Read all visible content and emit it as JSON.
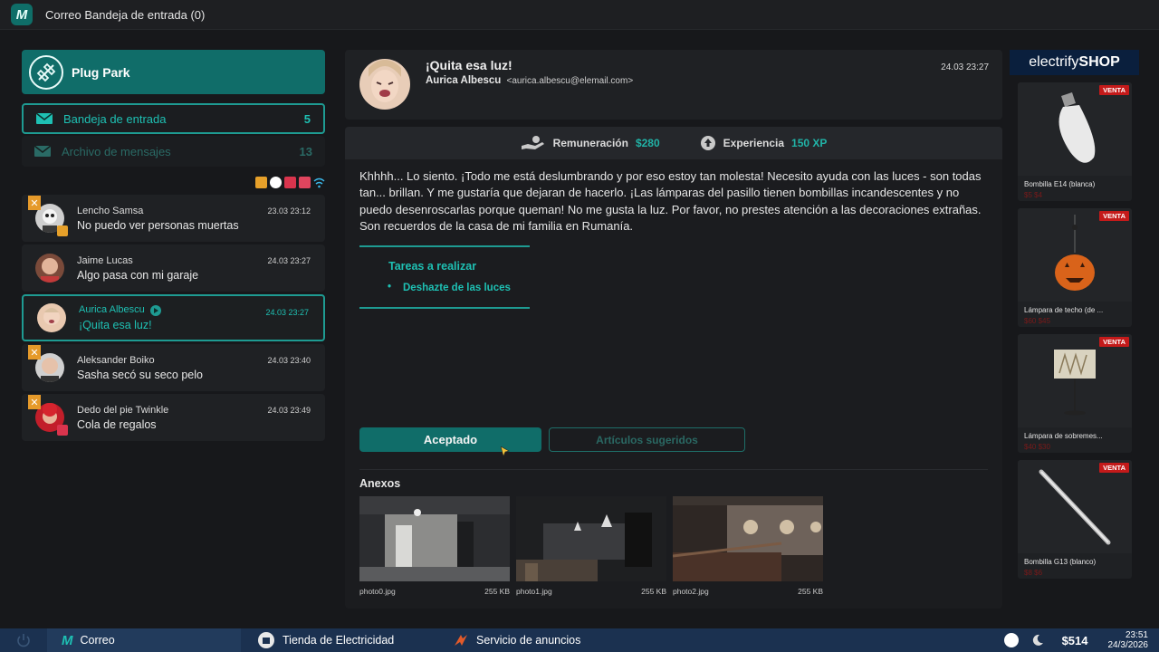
{
  "window": {
    "title": "Correo  Bandeja de entrada (0)",
    "logo_letter": "M"
  },
  "sidebar": {
    "brand": "Plug Park",
    "folders": [
      {
        "label": "Bandeja de entrada",
        "count": "5"
      },
      {
        "label": "Archivo de mensajes",
        "count": "13"
      }
    ],
    "status_icons": [
      "camera-icon",
      "settings-icon",
      "fire-icon",
      "pocket-icon",
      "wifi-icon"
    ]
  },
  "messages": [
    {
      "sender": "Lencho Samsa",
      "subject": "No puedo ver personas muertas",
      "date": "23.03 23:12"
    },
    {
      "sender": "Jaime Lucas",
      "subject": "Algo pasa con mi garaje",
      "date": "24.03 23:27"
    },
    {
      "sender": "Aurica Albescu",
      "subject": "¡Quita esa luz!",
      "date": "24.03 23:27"
    },
    {
      "sender": "Aleksander Boiko",
      "subject": "Sasha secó su seco pelo",
      "date": "24.03 23:40"
    },
    {
      "sender": "Dedo del pie Twinkle",
      "subject": "Cola de regalos",
      "date": "24.03 23:49"
    }
  ],
  "mail": {
    "subject": "¡Quita esa luz!",
    "sender_name": "Aurica Albescu",
    "sender_email": "<aurica.albescu@elemail.com>",
    "date": "24.03 23:27",
    "reward_label": "Remuneración",
    "reward_value": "$280",
    "xp_label": "Experiencia",
    "xp_value": "150 XP",
    "body": "Khhhh... Lo siento. ¡Todo me está deslumbrando y por eso estoy tan molesta! Necesito ayuda con las luces - son todas tan... brillan. Y me gustaría que dejaran de hacerlo. ¡Las lámparas del pasillo tienen bombillas incandescentes y no puedo desenroscarlas porque queman! No me gusta la luz. Por favor, no prestes atención a las decoraciones extrañas. Son recuerdos de la casa de mi familia en Rumanía.",
    "tasks_title": "Tareas a realizar",
    "task_item": "Deshazte de las luces",
    "accept_label": "Aceptado",
    "suggest_label": "Artículos sugeridos",
    "attachments_title": "Anexos",
    "attachments": [
      {
        "name": "photo0.jpg",
        "size": "255 KB"
      },
      {
        "name": "photo1.jpg",
        "size": "255 KB"
      },
      {
        "name": "photo2.jpg",
        "size": "255 KB"
      }
    ]
  },
  "shop": {
    "brand_light": "electrify",
    "brand_bold": "SHOP",
    "badge": "VENTA",
    "items": [
      {
        "name": "Bombilla E14 (blanca)",
        "price": "$5  $4"
      },
      {
        "name": "Lámpara de techo (de ...",
        "price": "$60  $45"
      },
      {
        "name": "Lámpara de sobremes...",
        "price": "$40  $30"
      },
      {
        "name": "Bombilla G13 (blanco)",
        "price": "$8  $6"
      }
    ]
  },
  "taskbar": {
    "apps": [
      "Correo",
      "Tienda de Electricidad",
      "Servicio de anuncios"
    ],
    "money": "$514",
    "time": "23:51",
    "date": "24/3/2026"
  },
  "colors": {
    "accent": "#1e9b92",
    "accent_dark": "#106d69",
    "sale": "#c41a1a",
    "shop_head": "#0a1f3d",
    "taskbar": "#1b3150"
  }
}
